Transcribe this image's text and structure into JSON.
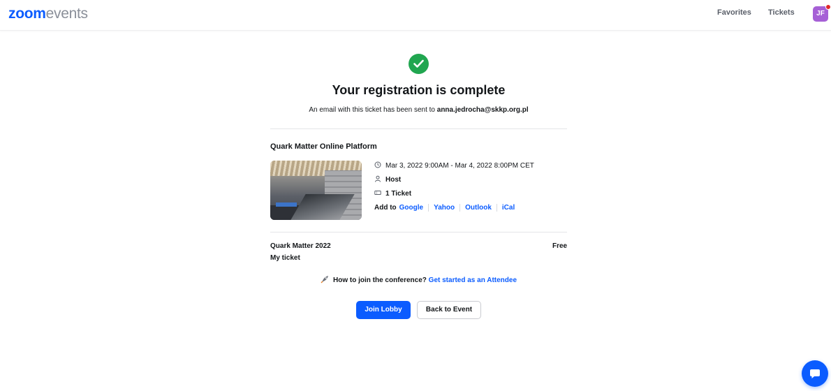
{
  "header": {
    "logo_brand": "zoom",
    "logo_product": "events",
    "favorites_label": "Favorites",
    "tickets_label": "Tickets",
    "avatar_initials": "JF"
  },
  "confirmation": {
    "icon": "check-circle-icon",
    "title": "Your registration is complete",
    "subtitle_prefix": "An email with this ticket has been sent to",
    "email": "anna.jedrocha@skkp.org.pl"
  },
  "event": {
    "name": "Quark Matter Online Platform",
    "date_range": "Mar 3, 2022 9:00AM - Mar 4, 2022 8:00PM CET",
    "host_label": "Host",
    "ticket_count": "1 Ticket",
    "add_to_label": "Add to",
    "calendars": [
      "Google",
      "Yahoo",
      "Outlook",
      "iCal"
    ]
  },
  "ticket": {
    "name": "Quark Matter 2022",
    "price": "Free",
    "type": "My ticket"
  },
  "help": {
    "question": "How to join the conference?",
    "link": "Get started as an Attendee"
  },
  "actions": {
    "join_lobby": "Join Lobby",
    "back_to_event": "Back to Event"
  },
  "colors": {
    "accent": "#0b5cff",
    "success": "#21a650",
    "avatar": "#a660d6",
    "notification": "#e02828"
  }
}
